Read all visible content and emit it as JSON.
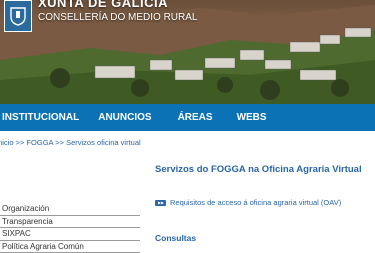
{
  "header": {
    "brand": "XUNTA DE GALICIA",
    "department": "CONSELLERÍA DO MEDIO RURAL"
  },
  "nav": {
    "items": [
      "INSTITUCIONAL",
      "ANUNCIOS",
      "ÁREAS",
      "WEBS"
    ]
  },
  "breadcrumb": {
    "items": [
      "Inicio",
      "FOGGA",
      "Servizos oficina virtual"
    ],
    "separator": ">>"
  },
  "sidebar": {
    "items": [
      "Organización",
      "Transparencia",
      "SIXPAC",
      "Política Agraria Común"
    ]
  },
  "main": {
    "title": "Servizos do FOGGA na Oficina Agraria Virtual",
    "link": "Requisitos de acceso á oficina agraria virtual (OAV)",
    "section": "Consultas"
  },
  "colors": {
    "nav_bg": "#0a72b5",
    "link": "#2a66a6"
  }
}
